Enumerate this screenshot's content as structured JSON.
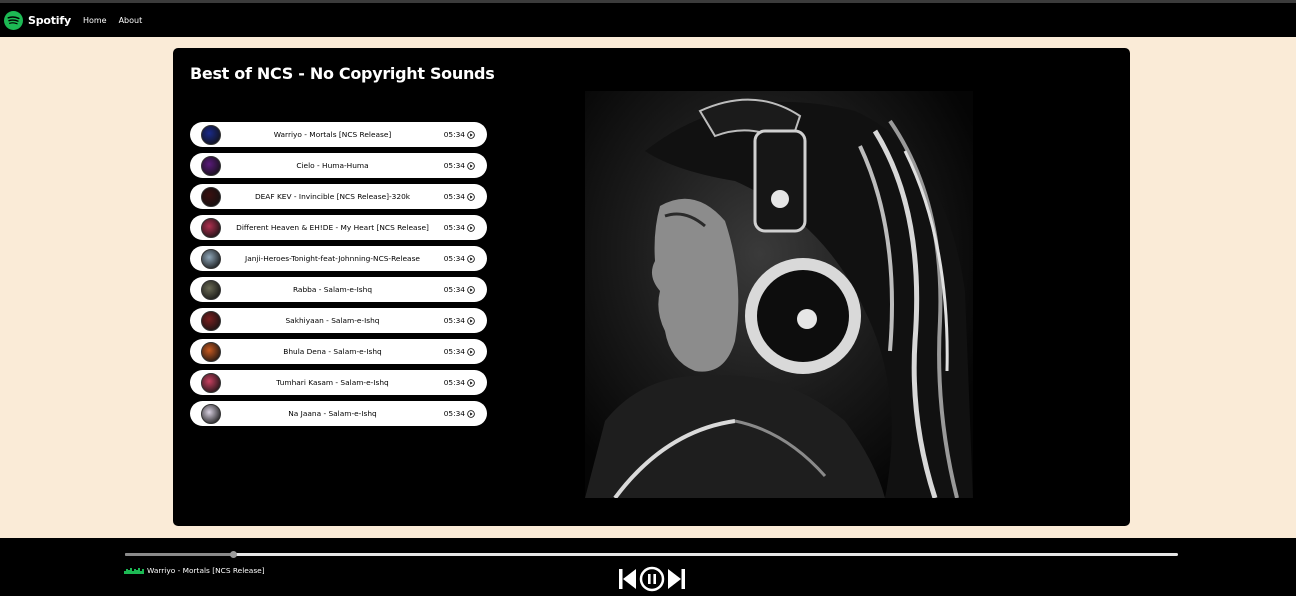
{
  "app": {
    "brand": "Spotify",
    "brand_color": "#1db954"
  },
  "nav": {
    "links": [
      "Home",
      "About"
    ]
  },
  "playlist": {
    "title": "Best of NCS - No Copyright Sounds",
    "songs": [
      {
        "name": "Warriyo - Mortals [NCS Release]",
        "duration": "05:34",
        "cover_color": "#1a2a8a"
      },
      {
        "name": "Cielo - Huma-Huma",
        "duration": "05:34",
        "cover_color": "#5a1a7a"
      },
      {
        "name": "DEAF KEV - Invincible [NCS Release]-320k",
        "duration": "05:34",
        "cover_color": "#3a1010"
      },
      {
        "name": "Different Heaven & EH!DE - My Heart [NCS Release]",
        "duration": "05:34",
        "cover_color": "#b03050"
      },
      {
        "name": "Janji-Heroes-Tonight-feat-Johnning-NCS-Release",
        "duration": "05:34",
        "cover_color": "#8fa6b8"
      },
      {
        "name": "Rabba - Salam-e-Ishq",
        "duration": "05:34",
        "cover_color": "#6a6a55"
      },
      {
        "name": "Sakhiyaan - Salam-e-Ishq",
        "duration": "05:34",
        "cover_color": "#7a2020"
      },
      {
        "name": "Bhula Dena - Salam-e-Ishq",
        "duration": "05:34",
        "cover_color": "#c85a20"
      },
      {
        "name": "Tumhari Kasam - Salam-e-Ishq",
        "duration": "05:34",
        "cover_color": "#c84060"
      },
      {
        "name": "Na Jaana - Salam-e-Ishq",
        "duration": "05:34",
        "cover_color": "#d8d0e0"
      }
    ]
  },
  "hero": {
    "icon": "headphones-girl-image"
  },
  "player": {
    "now_playing": "Warriyo - Mortals [NCS Release]",
    "progress": 0.103,
    "icons": [
      "previous-icon",
      "pause-icon",
      "next-icon"
    ]
  }
}
